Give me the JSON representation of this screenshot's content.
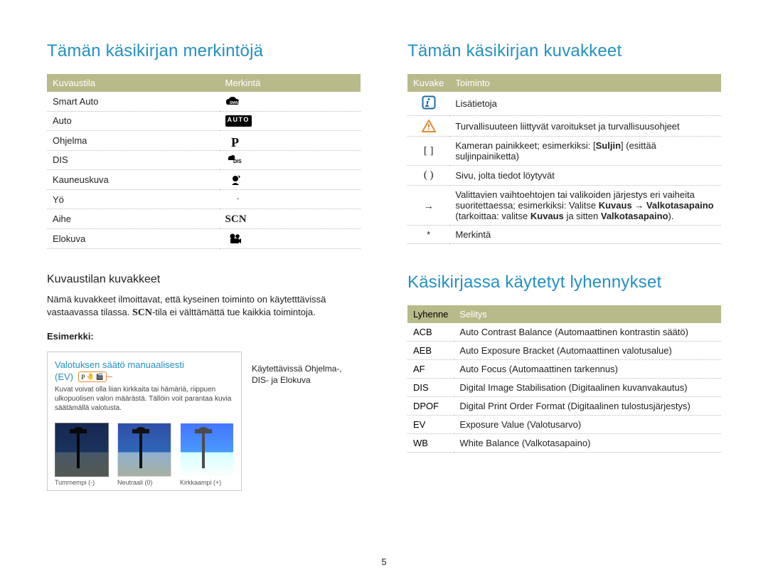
{
  "page_number": "5",
  "left": {
    "heading": "Tämän käsikirjan merkintöjä",
    "modes_table": {
      "head": [
        "Kuvaustila",
        "Merkintä"
      ],
      "rows": [
        {
          "label": "Smart Auto",
          "icon": "smart-icon"
        },
        {
          "label": "Auto",
          "icon": "auto-icon"
        },
        {
          "label": "Ohjelma",
          "icon": "p-icon",
          "glyph": "P"
        },
        {
          "label": "DIS",
          "icon": "dis-icon"
        },
        {
          "label": "Kauneuskuva",
          "icon": "beauty-icon"
        },
        {
          "label": "Yö",
          "icon": "night-icon"
        },
        {
          "label": "Aihe",
          "icon": "scn-icon",
          "glyph": "SCN"
        },
        {
          "label": "Elokuva",
          "icon": "movie-icon"
        }
      ]
    },
    "section2_heading": "Kuvaustilan kuvakkeet",
    "section2_text_pre": "Nämä kuvakkeet ilmoittavat, että kyseinen toiminto on käytetttävissä vastaavassa tilassa. ",
    "section2_scn": "SCN",
    "section2_text_post": "-tila ei välttämättä tue kaikkia toimintoja.",
    "example_label": "Esimerkki:",
    "example_box": {
      "title": "Valotuksen säätö manuaalisesti",
      "ev": "(EV)",
      "caption": "Kuvat voivat olla liian kirkkaita tai hämäriä, riippuen ulkopuolisen valon määrästä. Tällöin voit parantaa kuvia säätämällä valotusta.",
      "images": [
        {
          "label": "Tummempi (-)"
        },
        {
          "label": "Neutraali (0)"
        },
        {
          "label": "Kirkkaampi (+)"
        }
      ]
    },
    "side_label": "Käytettävissä Ohjelma-, DIS- ja Elokuva"
  },
  "right": {
    "heading1": "Tämän käsikirjan kuvakkeet",
    "icons_table": {
      "head": [
        "Kuvake",
        "Toiminto"
      ],
      "rows": [
        {
          "icon": "info-icon",
          "text": "Lisätietoja"
        },
        {
          "icon": "warning-icon",
          "text": "Turvallisuuteen liittyvät varoitukset ja turvallisuusohjeet"
        },
        {
          "icon": "square-brackets",
          "glyph": "[ ]",
          "text_pre": "Kameran painikkeet; esimerkiksi: [",
          "text_bold": "Suljin",
          "text_post": "] (esittää suljinpainiketta)"
        },
        {
          "icon": "parentheses",
          "glyph": "( )",
          "text": "Sivu, jolta tiedot löytyvät"
        },
        {
          "icon": "arrow",
          "glyph": "→",
          "text_pre": "Valittavien vaihtoehtojen tai valikoiden järjestys eri vaiheita suoritettaessa; esimerkiksi: Valitse ",
          "b1": "Kuvaus",
          "arrow1": " → ",
          "b2": "Valkotasapaino",
          "mid": " (tarkoittaa: valitse ",
          "b3": "Kuvaus",
          "mid2": " ja sitten ",
          "b4": "Valkotasapaino",
          "end": ")."
        },
        {
          "icon": "asterisk",
          "glyph": "*",
          "text": "Merkintä"
        }
      ]
    },
    "heading2": "Käsikirjassa käytetyt lyhennykset",
    "abbrev_table": {
      "head": [
        "Lyhenne",
        "Selitys"
      ],
      "rows": [
        {
          "abbr": "ACB",
          "desc": "Auto Contrast Balance (Automaattinen kontrastin säätö)"
        },
        {
          "abbr": "AEB",
          "desc": "Auto Exposure Bracket (Automaattinen valotusalue)"
        },
        {
          "abbr": "AF",
          "desc": "Auto Focus (Automaattinen tarkennus)"
        },
        {
          "abbr": "DIS",
          "desc": "Digital Image Stabilisation (Digitaalinen kuvanvakautus)"
        },
        {
          "abbr": "DPOF",
          "desc": "Digital Print Order Format (Digitaalinen tulostusjärjestys)"
        },
        {
          "abbr": "EV",
          "desc": "Exposure Value (Valotusarvo)"
        },
        {
          "abbr": "WB",
          "desc": "White Balance (Valkotasapaino)"
        }
      ]
    }
  }
}
